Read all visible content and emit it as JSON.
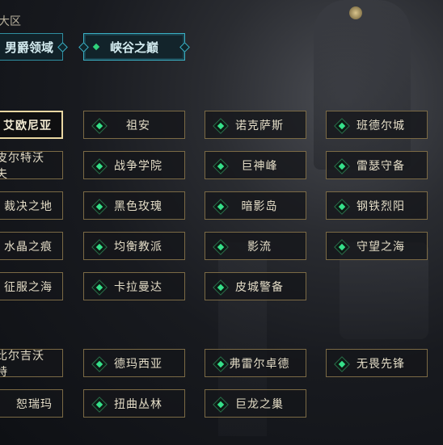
{
  "region_label": "大区",
  "tabs": [
    {
      "label": "男爵领域",
      "active": false
    },
    {
      "label": "峡谷之巅",
      "active": true
    }
  ],
  "servers": {
    "group1": [
      [
        "艾欧尼亚",
        "祖安",
        "诺克萨斯",
        "班德尔城"
      ],
      [
        "皮尔特沃夫",
        "战争学院",
        "巨神峰",
        "雷瑟守备"
      ],
      [
        "裁决之地",
        "黑色玫瑰",
        "暗影岛",
        "钢铁烈阳"
      ],
      [
        "水晶之痕",
        "均衡教派",
        "影流",
        "守望之海"
      ],
      [
        "征服之海",
        "卡拉曼达",
        "皮城警备"
      ]
    ],
    "group2": [
      [
        "比尔吉沃特",
        "德玛西亚",
        "弗雷尔卓德",
        "无畏先锋"
      ],
      [
        "恕瑞玛",
        "扭曲丛林",
        "巨龙之巢"
      ]
    ],
    "selected": "艾欧尼亚"
  },
  "colors": {
    "accent": "#36e08a",
    "tab_border": "#3ab0c4",
    "button_border": "#7b6a45",
    "selected_border": "#e9d7a2"
  },
  "icons": {
    "server_gem": "green-diamond-icon",
    "tab_marker": "diamond-icon"
  }
}
